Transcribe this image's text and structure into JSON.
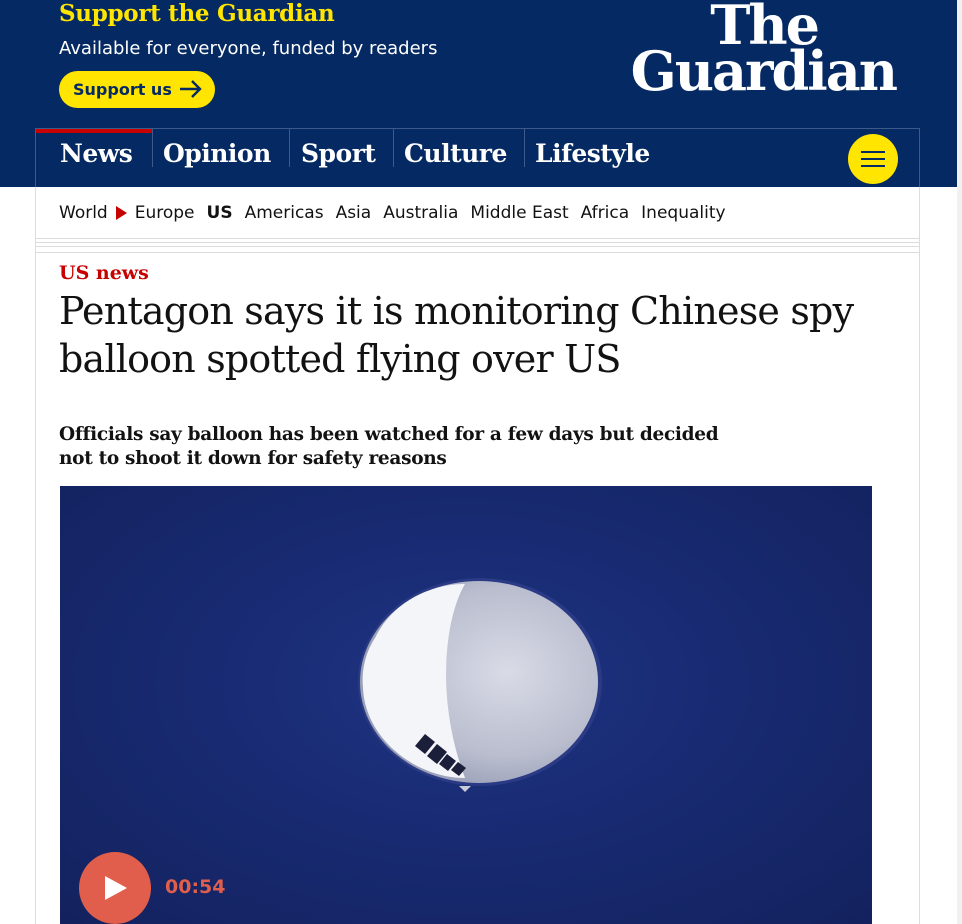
{
  "header": {
    "support_title": "Support the Guardian",
    "support_subtitle": "Available for everyone, funded by readers",
    "support_button": "Support us",
    "logo_line1": "The",
    "logo_line2": "Guardian",
    "colors": {
      "background": "#052962",
      "accent": "#ffe500",
      "active": "#c70000"
    }
  },
  "nav": {
    "items": [
      {
        "label": "News",
        "active": true
      },
      {
        "label": "Opinion"
      },
      {
        "label": "Sport"
      },
      {
        "label": "Culture"
      },
      {
        "label": "Lifestyle"
      }
    ],
    "menu_icon": "hamburger-icon"
  },
  "subnav": {
    "items": [
      {
        "label": "World"
      },
      {
        "label": "Europe"
      },
      {
        "label": "US",
        "current": true
      },
      {
        "label": "Americas"
      },
      {
        "label": "Asia"
      },
      {
        "label": "Australia"
      },
      {
        "label": "Middle East"
      },
      {
        "label": "Africa"
      },
      {
        "label": "Inequality"
      }
    ]
  },
  "article": {
    "kicker": "US news",
    "headline": "Pentagon says it is monitoring Chinese spy balloon spotted flying over US",
    "standfirst": "Officials say balloon has been watched for a few days but decided not to shoot it down for safety reasons",
    "video": {
      "duration": "00:54",
      "play_icon": "play-icon"
    }
  }
}
